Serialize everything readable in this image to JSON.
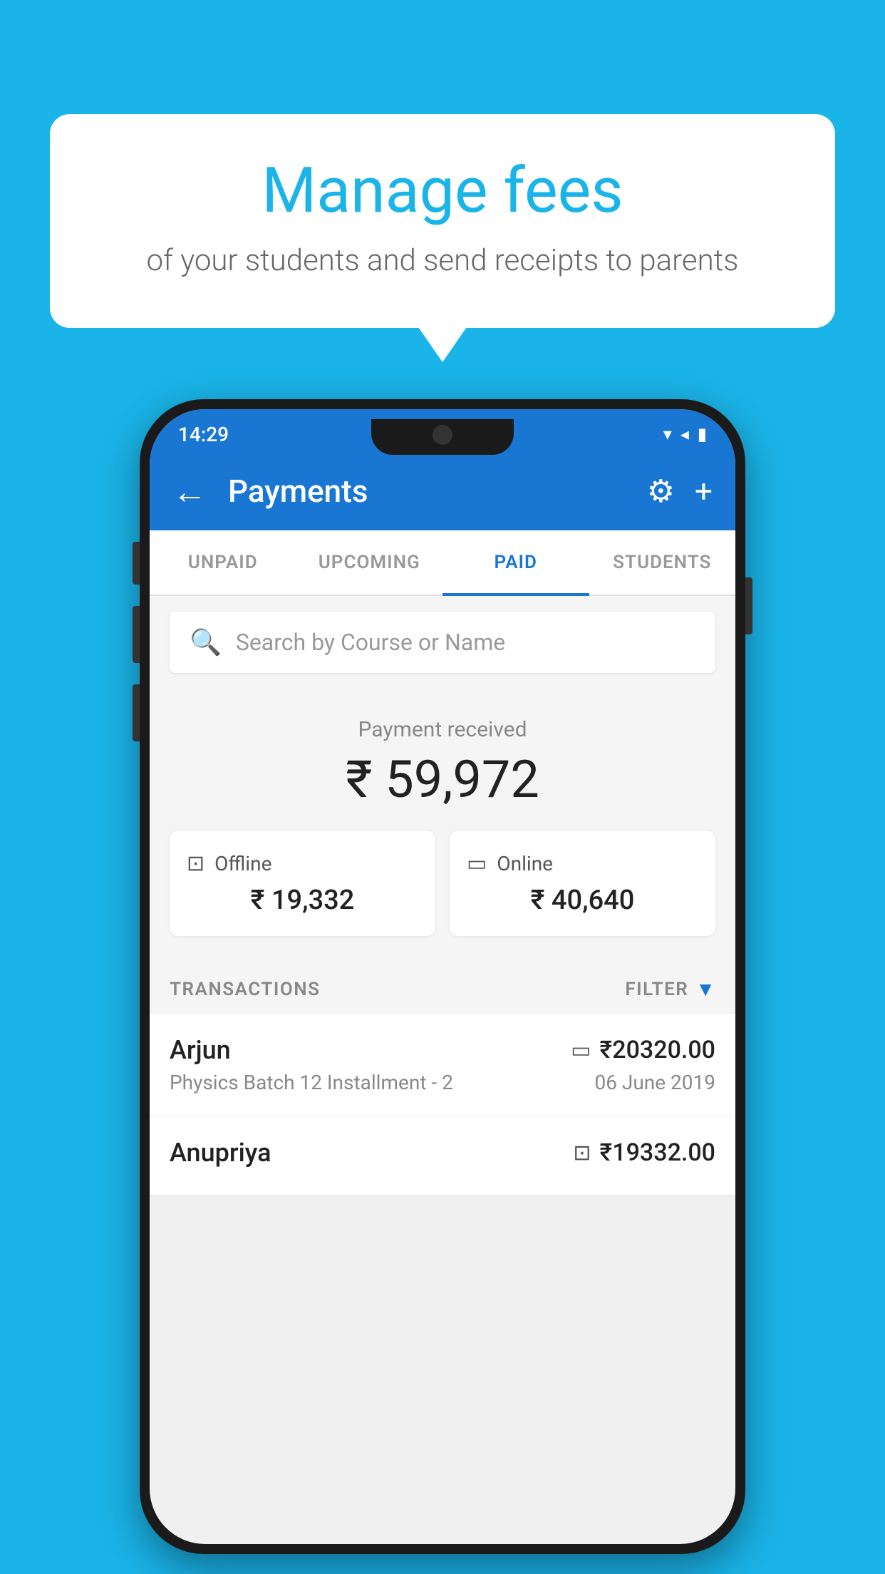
{
  "background_color": "#1ab4e8",
  "speech_bubble": {
    "title": "Manage fees",
    "subtitle": "of your students and send receipts to parents"
  },
  "status_bar": {
    "time": "14:29",
    "wifi": "▼",
    "signal": "▲",
    "battery": "▓"
  },
  "app_bar": {
    "title": "Payments",
    "back_label": "←",
    "gear_label": "⚙",
    "plus_label": "+"
  },
  "tabs": [
    {
      "label": "UNPAID",
      "active": false
    },
    {
      "label": "UPCOMING",
      "active": false
    },
    {
      "label": "PAID",
      "active": true
    },
    {
      "label": "STUDENTS",
      "active": false
    }
  ],
  "search": {
    "placeholder": "Search by Course or Name"
  },
  "payment_summary": {
    "label": "Payment received",
    "amount": "₹ 59,972",
    "offline": {
      "label": "Offline",
      "amount": "₹ 19,332"
    },
    "online": {
      "label": "Online",
      "amount": "₹ 40,640"
    }
  },
  "transactions": {
    "header_label": "TRANSACTIONS",
    "filter_label": "FILTER",
    "rows": [
      {
        "name": "Arjun",
        "course": "Physics Batch 12 Installment - 2",
        "amount": "₹20320.00",
        "date": "06 June 2019",
        "payment_type": "card"
      },
      {
        "name": "Anupriya",
        "course": "",
        "amount": "₹19332.00",
        "date": "",
        "payment_type": "offline"
      }
    ]
  }
}
